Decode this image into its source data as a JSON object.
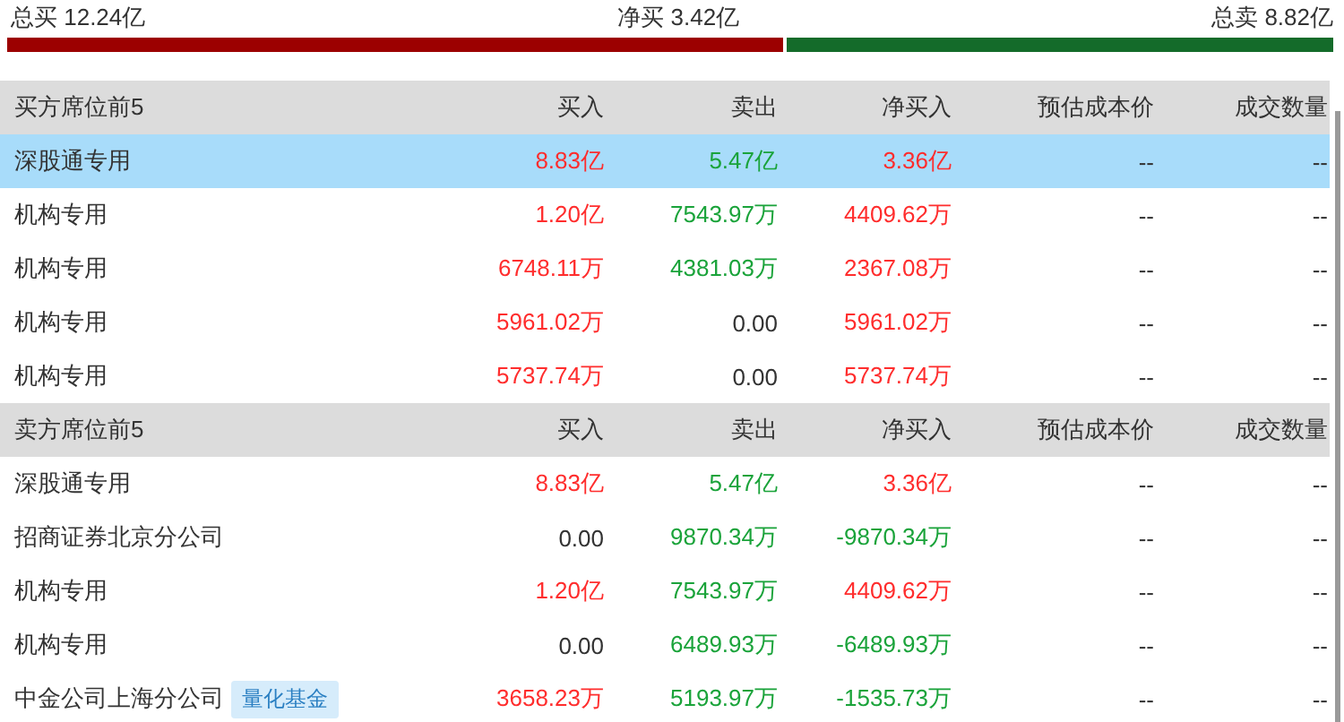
{
  "summary": {
    "total_buy": "总买 12.24亿",
    "net_buy": "净买 3.42亿",
    "total_sell": "总卖 8.82亿",
    "level": 0.585
  },
  "sections": [
    {
      "columns": [
        "买方席位前5",
        "买入",
        "卖出",
        "净买入",
        "预估成本价",
        "成交数量"
      ],
      "rows": [
        {
          "name": "深股通专用",
          "selected": true,
          "buy": {
            "text": "8.83亿",
            "color": "#ff2d2d"
          },
          "sell": {
            "text": "5.47亿",
            "color": "#1aa33a"
          },
          "net": {
            "text": "3.36亿",
            "color": "#ff2d2d"
          },
          "cost": "--",
          "volume": "--"
        },
        {
          "name": "机构专用",
          "selected": false,
          "buy": {
            "text": "1.20亿",
            "color": "#ff2d2d"
          },
          "sell": {
            "text": "7543.97万",
            "color": "#1aa33a"
          },
          "net": {
            "text": "4409.62万",
            "color": "#ff2d2d"
          },
          "cost": "--",
          "volume": "--"
        },
        {
          "name": "机构专用",
          "selected": false,
          "buy": {
            "text": "6748.11万",
            "color": "#ff2d2d"
          },
          "sell": {
            "text": "4381.03万",
            "color": "#1aa33a"
          },
          "net": {
            "text": "2367.08万",
            "color": "#ff2d2d"
          },
          "cost": "--",
          "volume": "--"
        },
        {
          "name": "机构专用",
          "selected": false,
          "buy": {
            "text": "5961.02万",
            "color": "#ff2d2d"
          },
          "sell": {
            "text": "0.00",
            "color": "#333333"
          },
          "net": {
            "text": "5961.02万",
            "color": "#ff2d2d"
          },
          "cost": "--",
          "volume": "--"
        },
        {
          "name": "机构专用",
          "selected": false,
          "buy": {
            "text": "5737.74万",
            "color": "#ff2d2d"
          },
          "sell": {
            "text": "0.00",
            "color": "#333333"
          },
          "net": {
            "text": "5737.74万",
            "color": "#ff2d2d"
          },
          "cost": "--",
          "volume": "--"
        }
      ]
    },
    {
      "columns": [
        "卖方席位前5",
        "买入",
        "卖出",
        "净买入",
        "预估成本价",
        "成交数量"
      ],
      "rows": [
        {
          "name": "深股通专用",
          "selected": false,
          "buy": {
            "text": "8.83亿",
            "color": "#ff2d2d"
          },
          "sell": {
            "text": "5.47亿",
            "color": "#1aa33a"
          },
          "net": {
            "text": "3.36亿",
            "color": "#ff2d2d"
          },
          "cost": "--",
          "volume": "--"
        },
        {
          "name": "招商证券北京分公司",
          "selected": false,
          "buy": {
            "text": "0.00",
            "color": "#333333"
          },
          "sell": {
            "text": "9870.34万",
            "color": "#1aa33a"
          },
          "net": {
            "text": "-9870.34万",
            "color": "#1aa33a"
          },
          "cost": "--",
          "volume": "--"
        },
        {
          "name": "机构专用",
          "selected": false,
          "buy": {
            "text": "1.20亿",
            "color": "#ff2d2d"
          },
          "sell": {
            "text": "7543.97万",
            "color": "#1aa33a"
          },
          "net": {
            "text": "4409.62万",
            "color": "#ff2d2d"
          },
          "cost": "--",
          "volume": "--"
        },
        {
          "name": "机构专用",
          "selected": false,
          "buy": {
            "text": "0.00",
            "color": "#333333"
          },
          "sell": {
            "text": "6489.93万",
            "color": "#1aa33a"
          },
          "net": {
            "text": "-6489.93万",
            "color": "#1aa33a"
          },
          "cost": "--",
          "volume": "--"
        },
        {
          "name": "中金公司上海分公司",
          "tag": "量化基金",
          "selected": false,
          "buy": {
            "text": "3658.23万",
            "color": "#ff2d2d"
          },
          "sell": {
            "text": "5193.97万",
            "color": "#1aa33a"
          },
          "net": {
            "text": "-1535.73万",
            "color": "#1aa33a"
          },
          "cost": "--",
          "volume": "--"
        }
      ]
    }
  ]
}
